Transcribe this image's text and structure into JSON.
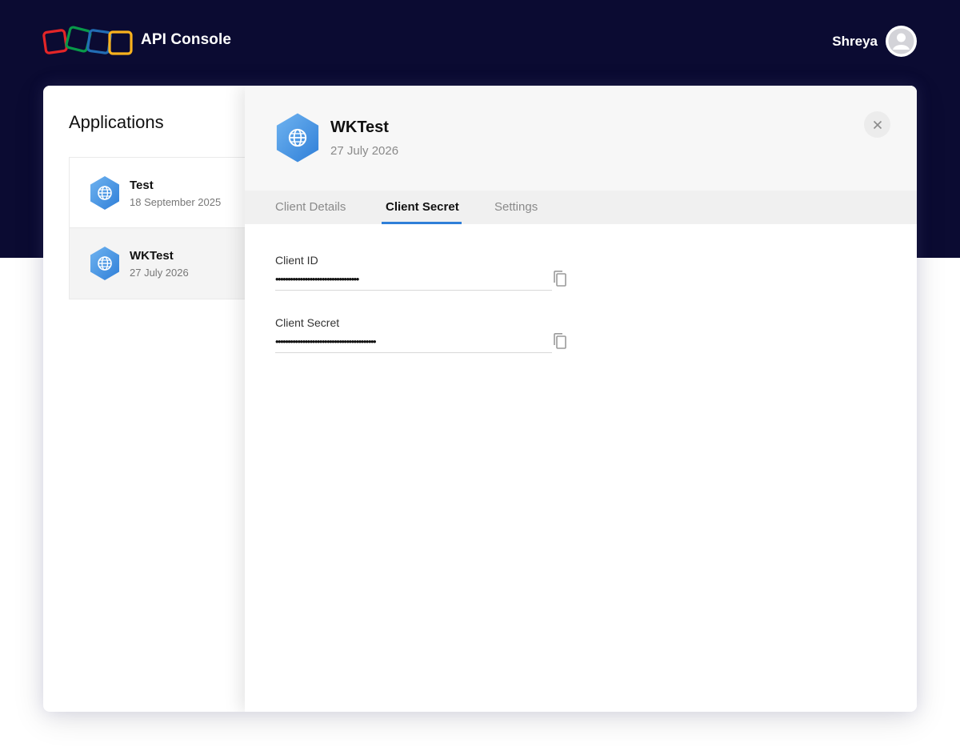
{
  "header": {
    "app_title": "API Console",
    "user_name": "Shreya",
    "colors": {
      "background": "#0b0b32",
      "accent": "#2f7fd8"
    }
  },
  "sidebar": {
    "heading": "Applications",
    "apps": [
      {
        "name": "Test",
        "date": "18 September 2025",
        "icon": "globe-icon"
      },
      {
        "name": "WKTest",
        "date": "27 July 2026",
        "icon": "globe-icon",
        "selected": true
      }
    ]
  },
  "panel": {
    "title": "WKTest",
    "date": "27 July 2026",
    "icon": "globe-icon",
    "tabs": [
      {
        "label": "Client Details"
      },
      {
        "label": "Client Secret",
        "active": true
      },
      {
        "label": "Settings"
      }
    ],
    "fields": [
      {
        "label": "Client ID",
        "value": "••••••••••••••••••••••••••••••••••",
        "icon": "copy-icon"
      },
      {
        "label": "Client Secret",
        "value": "•••••••••••••••••••••••••••••••••••••••••",
        "icon": "copy-icon"
      }
    ]
  }
}
